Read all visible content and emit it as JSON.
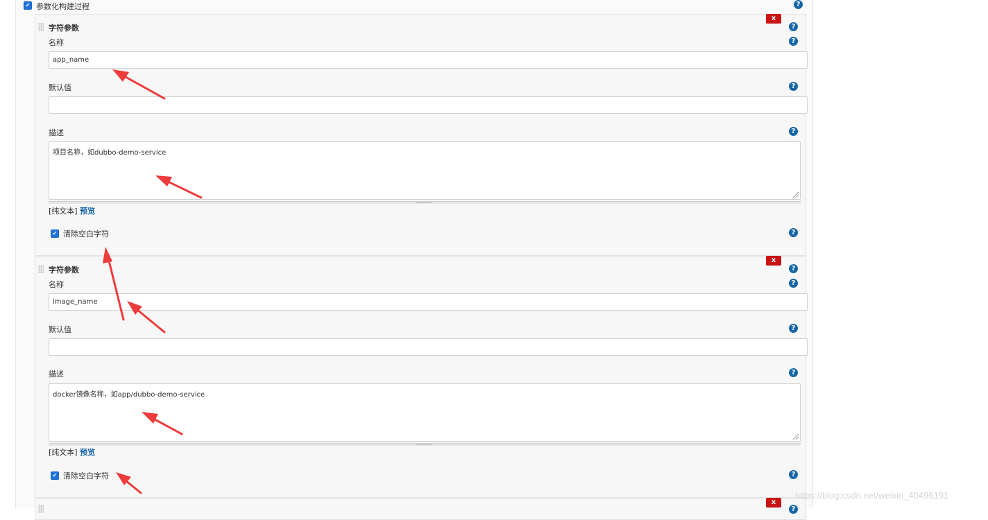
{
  "section": {
    "checkbox_label": "参数化构建过程",
    "checked": true
  },
  "params": [
    {
      "type_label": "字符参数",
      "name_label": "名称",
      "name_value": "app_name",
      "default_label": "默认值",
      "default_value": "",
      "desc_label": "描述",
      "desc_value": "项目名称，如dubbo-demo-service",
      "format_text": "[纯文本]",
      "preview_link": "预览",
      "trim_label": "清除空白字符",
      "trim_checked": true,
      "close_label": "x"
    },
    {
      "type_label": "字符参数",
      "name_label": "名称",
      "name_value": "image_name",
      "default_label": "默认值",
      "default_value": "",
      "desc_label": "描述",
      "desc_value": "docker镜像名称，如app/dubbo-demo-service",
      "format_text": "[纯文本]",
      "preview_link": "预览",
      "trim_label": "清除空白字符",
      "trim_checked": true,
      "close_label": "x"
    },
    {
      "close_label": "x"
    }
  ],
  "help_glyph": "?",
  "watermark": "https://blog.csdn.net/weixin_40496191",
  "colors": {
    "accent": "#1666a8",
    "close": "#c81414",
    "annotation_arrow": "#ee3b3b",
    "checkbox": "#1e73d8"
  },
  "icons": [
    "checkbox-checked-icon",
    "help-icon",
    "close-icon",
    "drag-handle-icon",
    "resize-handle-icon"
  ]
}
